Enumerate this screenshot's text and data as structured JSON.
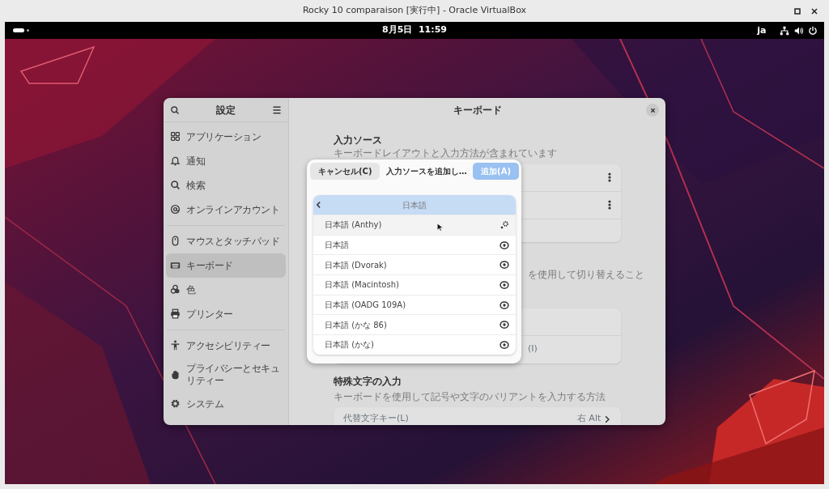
{
  "vm_window": {
    "title": "Rocky 10 comparaison [実行中] - Oracle VirtualBox"
  },
  "top_bar": {
    "clock": "8月5日  11:59",
    "input_method": "ja"
  },
  "settings": {
    "sidebar": {
      "title": "設定",
      "groups": [
        [
          {
            "label": "アプリケーション",
            "kind": "apps",
            "selected": false
          },
          {
            "label": "通知",
            "kind": "bell",
            "selected": false
          },
          {
            "label": "検索",
            "kind": "search",
            "selected": false
          },
          {
            "label": "オンラインアカウント",
            "kind": "at",
            "selected": false
          }
        ],
        [
          {
            "label": "マウスとタッチパッド",
            "kind": "mouse",
            "selected": false
          },
          {
            "label": "キーボード",
            "kind": "keyboard",
            "selected": true
          },
          {
            "label": "色",
            "kind": "color",
            "selected": false
          },
          {
            "label": "プリンター",
            "kind": "printer",
            "selected": false
          }
        ],
        [
          {
            "label": "アクセシビリティー",
            "kind": "person",
            "selected": false
          },
          {
            "label": "プライバシーとセキュリティー",
            "kind": "hand",
            "selected": false
          },
          {
            "label": "システム",
            "kind": "gear",
            "selected": false
          }
        ]
      ]
    },
    "page": {
      "title": "キーボード",
      "input_sources": {
        "title": "入力ソース",
        "description": "キーボードレイアウトと入力方法が含まれています"
      },
      "switching": {
        "description_fragment": "を使用して切り替えること",
        "row_fragment": "(I)"
      },
      "special_characters": {
        "title": "特殊文字の入力",
        "description": "キーボードを使用して記号や文字のバリアントを入力する方法",
        "rows": [
          {
            "label": "代替文字キー(L)",
            "value": "右 Alt"
          }
        ]
      }
    }
  },
  "dialog": {
    "cancel": "キャンセル(C)",
    "title": "入力ソースを追加し…",
    "add": {
      "label": "追加(A)",
      "disabled": true
    },
    "language": "日本語",
    "sources": [
      {
        "label": "日本語 (Anthy)",
        "kind": "settings",
        "hovered": true
      },
      {
        "label": "日本語",
        "kind": "preview",
        "hovered": false
      },
      {
        "label": "日本語 (Dvorak)",
        "kind": "preview",
        "hovered": false
      },
      {
        "label": "日本語 (Macintosh)",
        "kind": "preview",
        "hovered": false
      },
      {
        "label": "日本語 (OADG 109A)",
        "kind": "preview",
        "hovered": false
      },
      {
        "label": "日本語 (かな 86)",
        "kind": "preview",
        "hovered": false
      },
      {
        "label": "日本語 (かな)",
        "kind": "preview",
        "hovered": false
      }
    ]
  }
}
